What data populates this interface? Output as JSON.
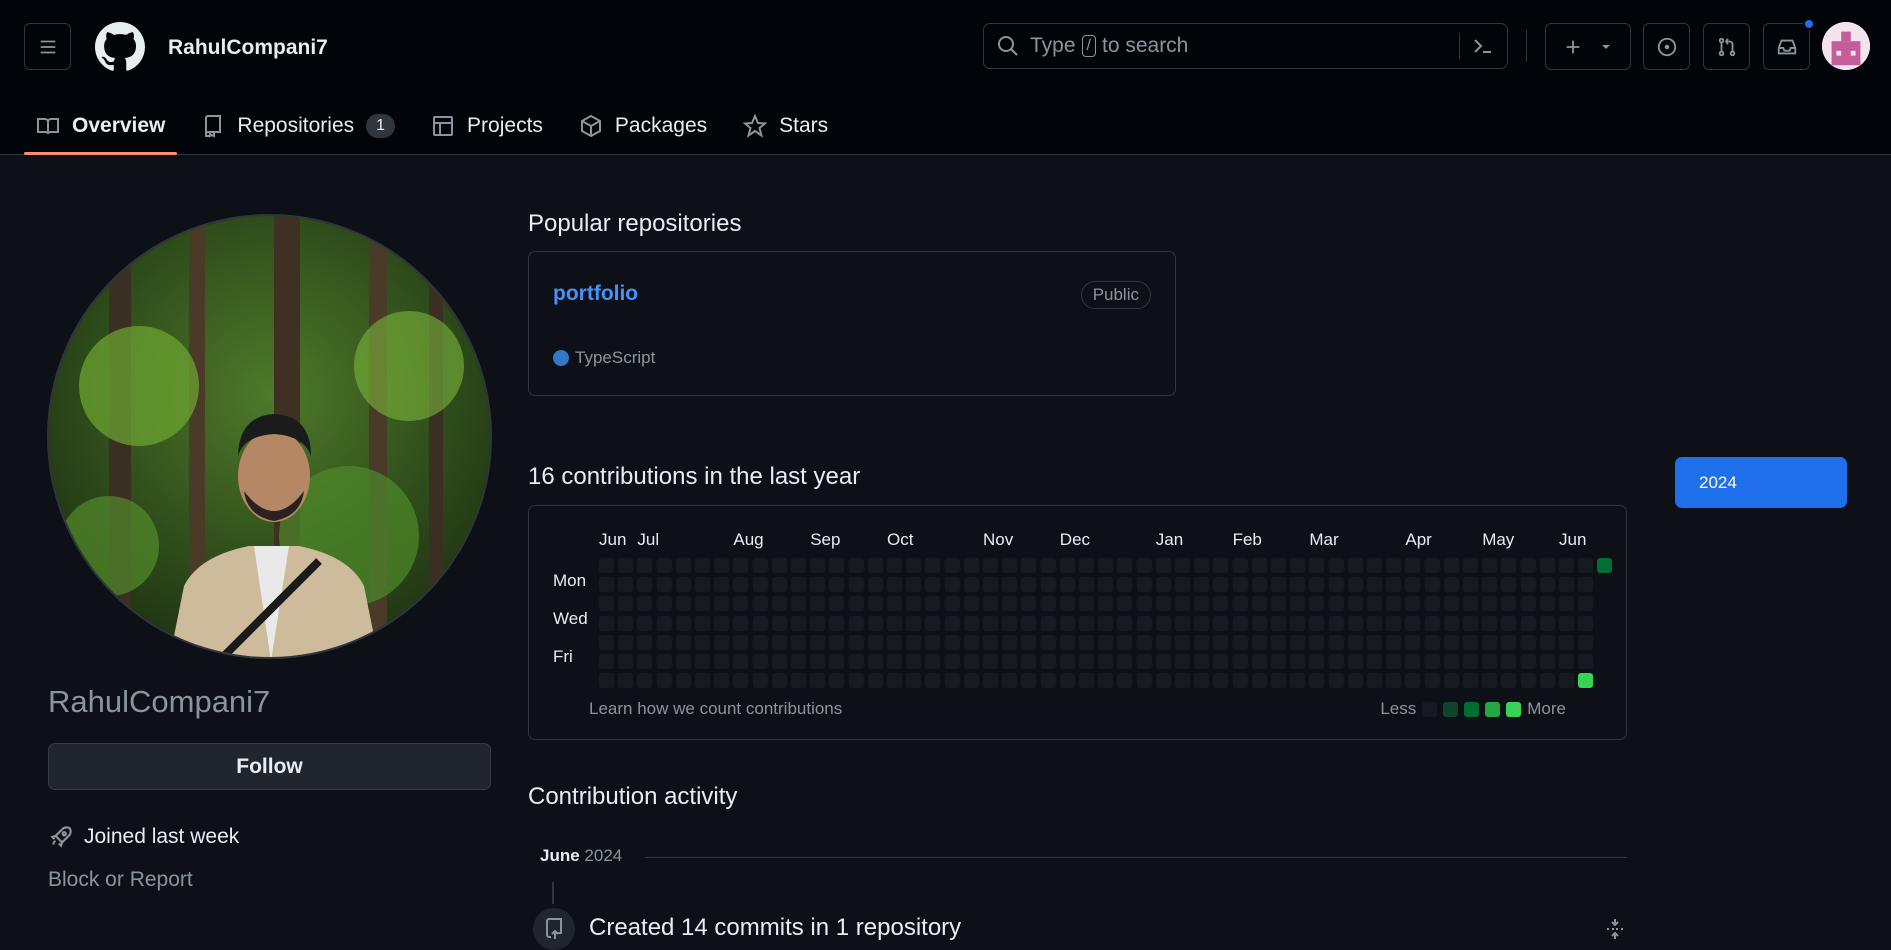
{
  "header": {
    "username": "RahulCompani7",
    "search": {
      "prefix": "Type",
      "key": "/",
      "suffix": "to search"
    }
  },
  "tabs": [
    {
      "label": "Overview",
      "icon": "book-icon",
      "active": true
    },
    {
      "label": "Repositories",
      "icon": "repo-icon",
      "count": "1"
    },
    {
      "label": "Projects",
      "icon": "table-icon"
    },
    {
      "label": "Packages",
      "icon": "package-icon"
    },
    {
      "label": "Stars",
      "icon": "star-icon"
    }
  ],
  "profile": {
    "name": "RahulCompani7",
    "follow_label": "Follow",
    "joined": "Joined last week",
    "block_report": "Block or Report"
  },
  "popular": {
    "title": "Popular repositories",
    "repos": [
      {
        "name": "portfolio",
        "visibility": "Public",
        "language": "TypeScript",
        "language_color": "#3178c6"
      }
    ]
  },
  "contributions": {
    "title": "16 contributions in the last year",
    "months": [
      "Jun",
      "Jul",
      "Aug",
      "Sep",
      "Oct",
      "Nov",
      "Dec",
      "Jan",
      "Feb",
      "Mar",
      "Apr",
      "May",
      "Jun"
    ],
    "days": [
      "Mon",
      "Wed",
      "Fri"
    ],
    "learn": "Learn how we count contributions",
    "legend_less": "Less",
    "legend_more": "More",
    "colors": [
      "#161b22",
      "#0e4429",
      "#006d32",
      "#26a641",
      "#39d353"
    ],
    "active_cells": [
      {
        "week": 51,
        "day": 6,
        "level": 4
      },
      {
        "week": 52,
        "day": 0,
        "level": 2
      },
      {
        "week": 52,
        "day": 1,
        "level": 2
      },
      {
        "week": 52,
        "day": 2,
        "level": 1
      },
      {
        "week": 52,
        "day": 3,
        "level": 4
      },
      {
        "week": 52,
        "day": 6,
        "level": 2
      }
    ]
  },
  "year_selector": {
    "selected": "2024"
  },
  "activity": {
    "title": "Contribution activity",
    "month": "June",
    "year": "2024",
    "item": "Created 14 commits in 1 repository"
  }
}
